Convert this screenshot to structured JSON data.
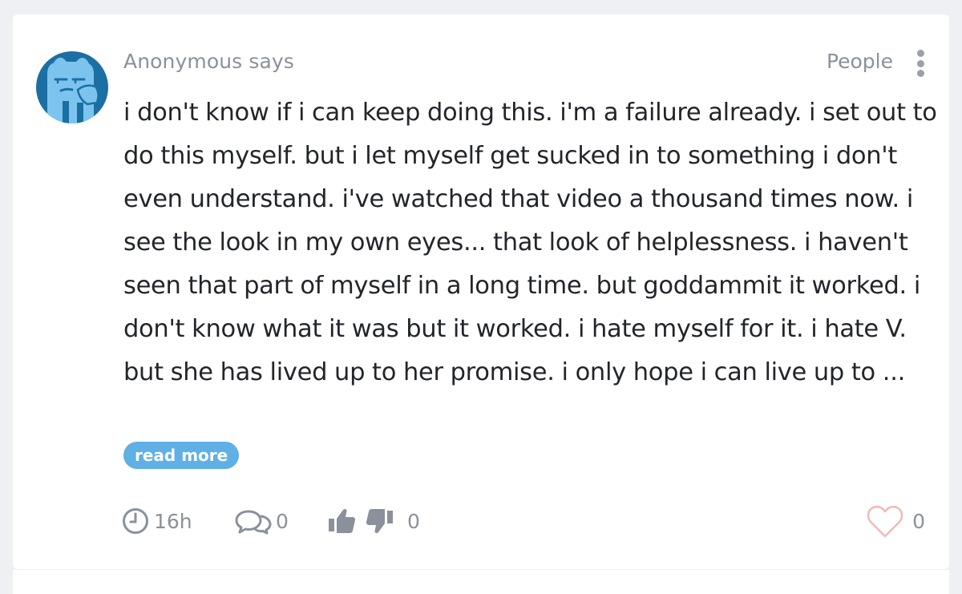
{
  "post": {
    "author_line": "Anonymous says",
    "category": "People",
    "body": "i don't know if i can keep doing this. i'm a failure already. i set out to do this myself. but i let myself get sucked in to something i don't even understand. i've watched that video a thousand times now. i see the look in my own eyes... that look of helplessness. i haven't seen that part of myself in a long time. but goddammit it worked. i don't know what it was but it worked. i hate myself for it. i hate V. but she has lived up to her promise. i only hope i can live up to ...",
    "read_more_label": "read more"
  },
  "footer": {
    "time": "16h",
    "comments_count": "0",
    "vote_score": "0",
    "likes_count": "0"
  },
  "icons": {
    "avatar": "anonymous-avatar-icon",
    "menu": "vertical-dots-icon",
    "clock": "clock-icon",
    "comments": "speech-bubbles-icon",
    "upvote": "thumbs-up-icon",
    "downvote": "thumbs-down-icon",
    "like": "heart-outline-icon"
  },
  "colors": {
    "background": "#eef0f3",
    "card": "#ffffff",
    "accent": "#5fb0e6",
    "avatar_dark": "#1b6fa3",
    "muted_text": "#8b919b",
    "body_text": "#22252a",
    "heart": "#f1b8b8"
  }
}
